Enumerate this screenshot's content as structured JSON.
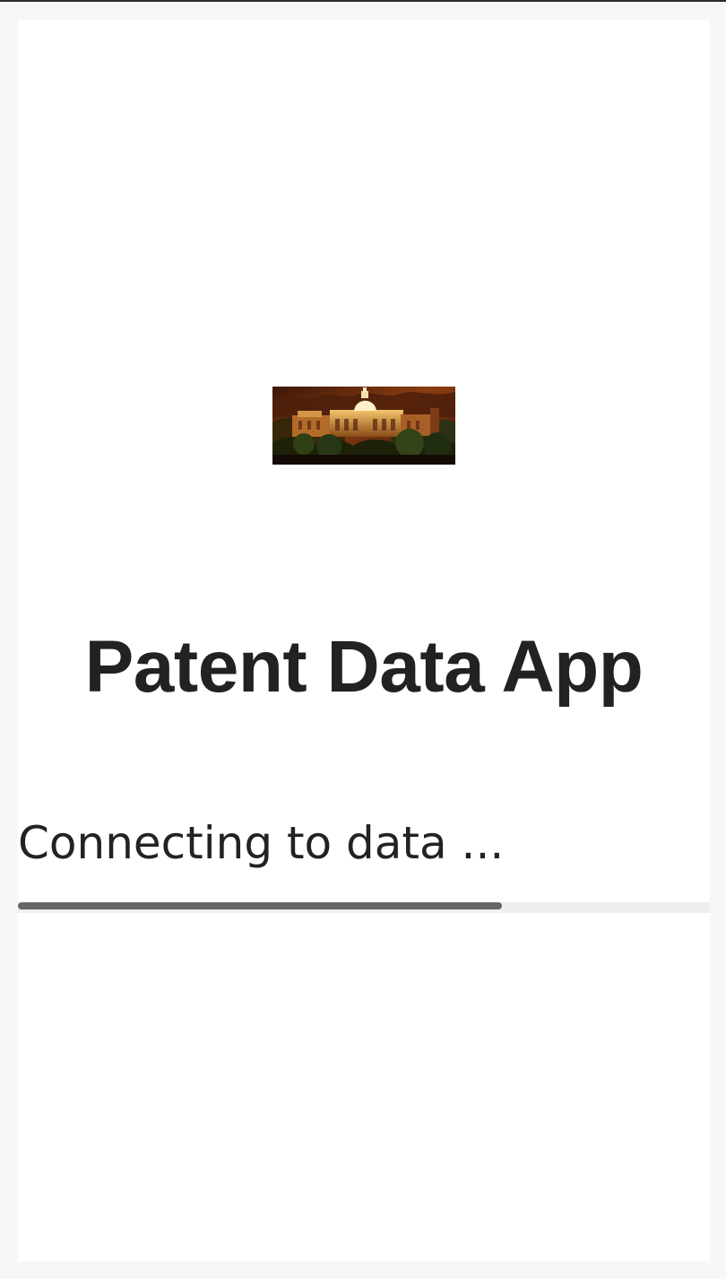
{
  "splash": {
    "image_icon": "building-photo",
    "title": "Patent Data App",
    "status_text": "Connecting to data ...",
    "progress_fraction": 0.7,
    "colors": {
      "page_background": "#f7f7f7",
      "panel_background": "#ffffff",
      "text": "#222222",
      "progress_fill": "#666666",
      "progress_track": "#efefef"
    }
  }
}
